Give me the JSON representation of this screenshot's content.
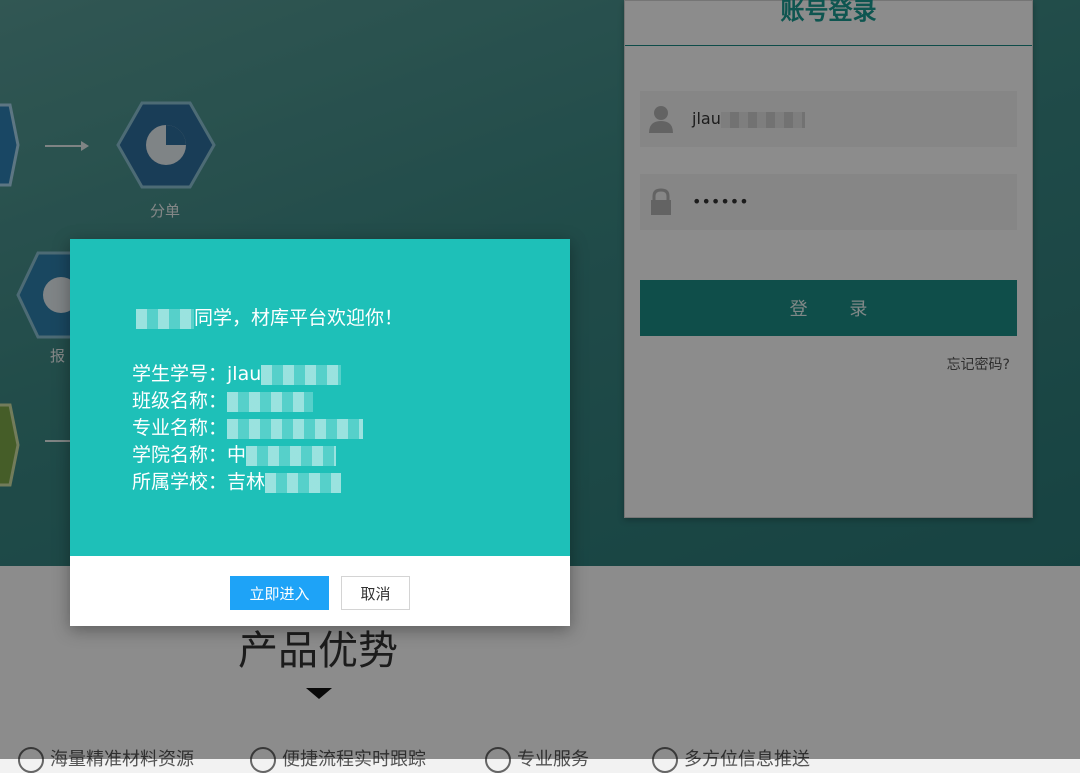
{
  "flow": {
    "step_split_label": "分单",
    "step_report_label": "报"
  },
  "login": {
    "title": "账号登录",
    "username_value": "jlau",
    "password_value": "••••••",
    "login_button": "登 录",
    "forgot_link": "忘记密码?"
  },
  "section": {
    "title": "产品优势",
    "features": [
      "海量精准材料资源",
      "便捷流程实时跟踪",
      "专业服务",
      "多方位信息推送"
    ]
  },
  "modal": {
    "welcome_suffix": "同学，材库平台欢迎你！",
    "rows": [
      {
        "label": "学生学号：",
        "value": "jlau"
      },
      {
        "label": "班级名称：",
        "value": ""
      },
      {
        "label": "专业名称：",
        "value": ""
      },
      {
        "label": "学院名称：",
        "value": "中"
      },
      {
        "label": "所属学校：",
        "value": "吉林"
      }
    ],
    "enter_button": "立即进入",
    "cancel_button": "取消"
  },
  "colors": {
    "modal_teal": "#1ec0b8",
    "primary_blue": "#1ea3f7",
    "login_button": "#1d8f88"
  }
}
